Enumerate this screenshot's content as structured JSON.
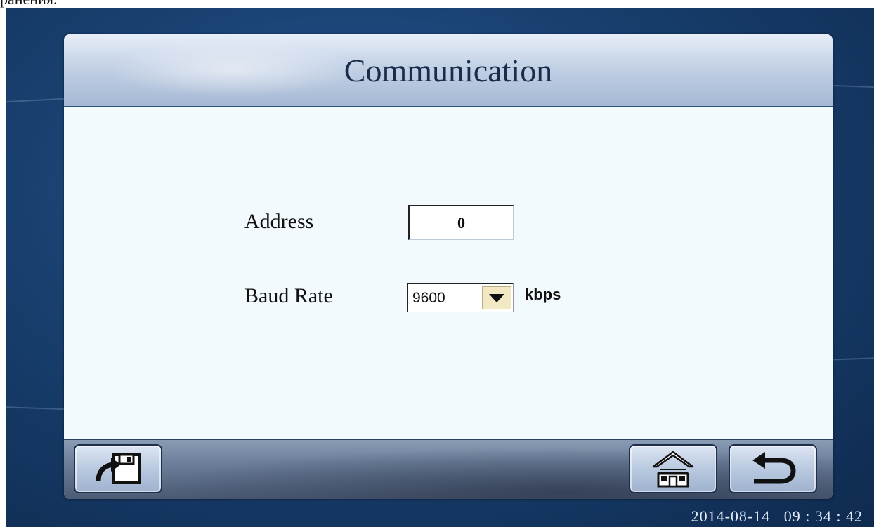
{
  "caption_fragment": "ранения.",
  "title": "Communication",
  "form": {
    "address_label": "Address",
    "address_value": "0",
    "baud_rate_label": "Baud Rate",
    "baud_rate_value": "9600",
    "baud_rate_unit": "kbps"
  },
  "toolbar": {
    "left_button_icon": "save-icon",
    "home_button_icon": "home-icon",
    "back_button_icon": "back-arrow-icon"
  },
  "status": {
    "date": "2014-08-14",
    "time": "09 : 34 : 42"
  },
  "colors": {
    "background": "#18406f",
    "panel": "#f2fafd",
    "title_bar": "#c3d1e6",
    "dropdown_button": "#f2e9c4"
  }
}
